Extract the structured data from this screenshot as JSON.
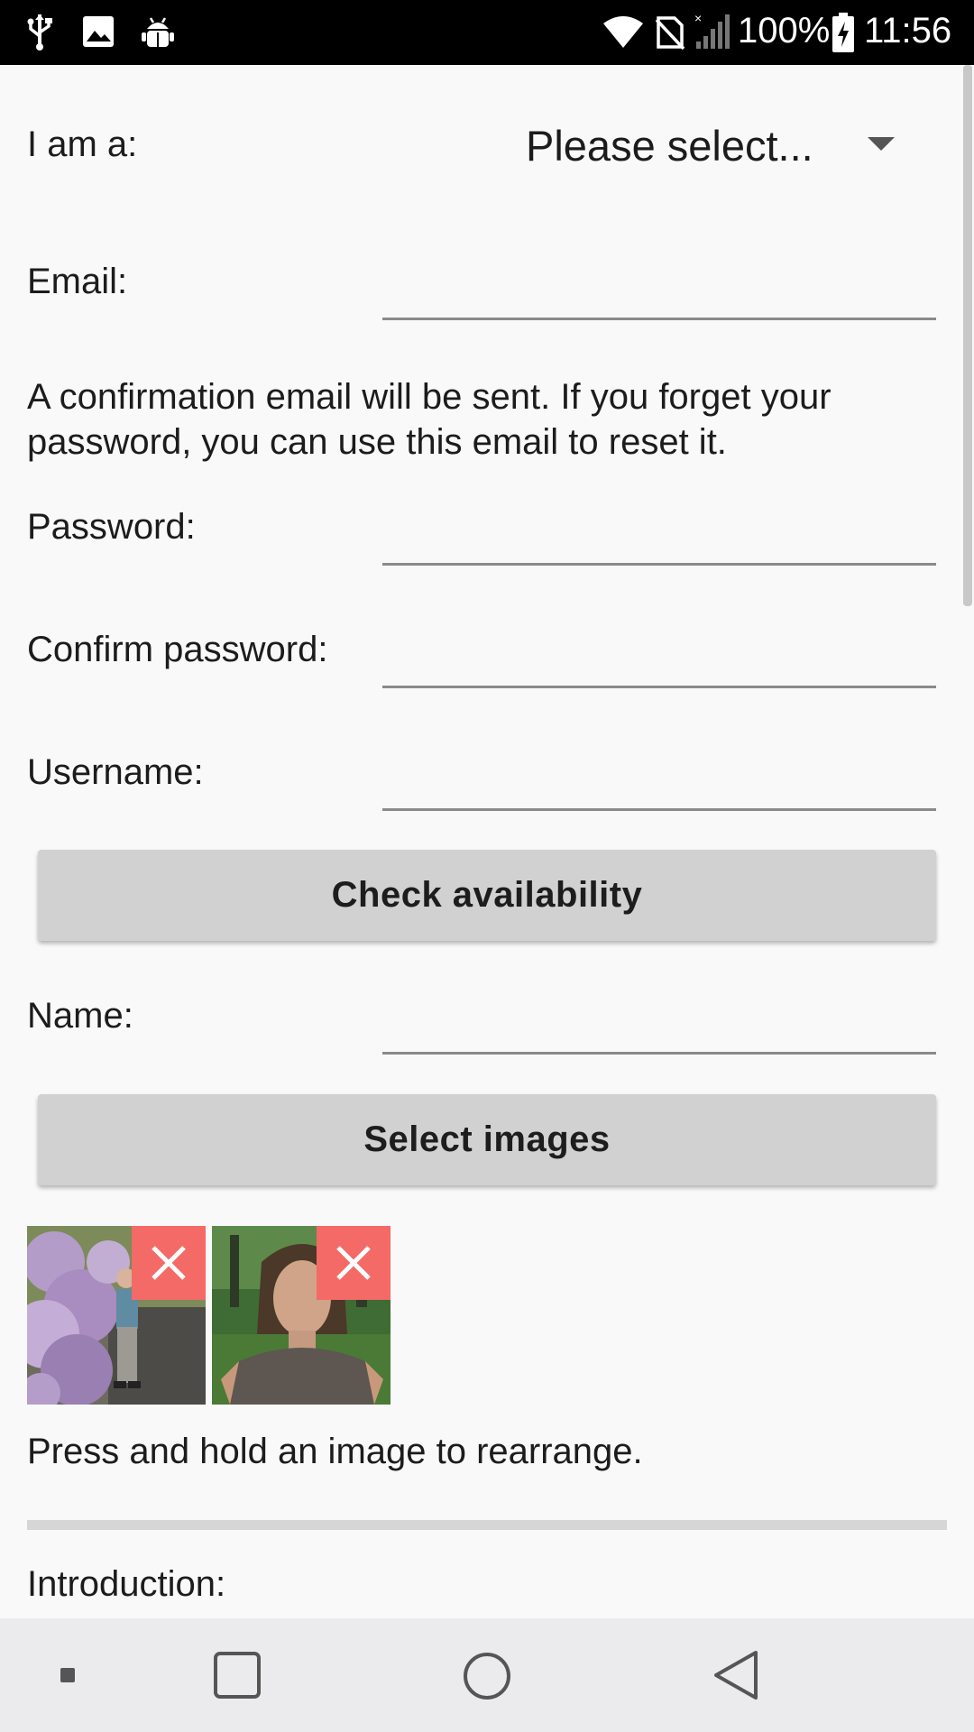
{
  "status_bar": {
    "battery": "100%",
    "time": "11:56",
    "icons": [
      "usb-icon",
      "image-icon",
      "android-debug-icon",
      "wifi-icon",
      "no-sim-icon",
      "signal-icon",
      "battery-charging-icon"
    ]
  },
  "form": {
    "role_label": "I am a:",
    "role_value": "Please select...",
    "email_label": "Email:",
    "email_value": "",
    "email_info": "A confirmation email will be sent. If you forget your password, you can use this email to reset it.",
    "password_label": "Password:",
    "password_value": "",
    "confirm_password_label": "Confirm password:",
    "confirm_password_value": "",
    "username_label": "Username:",
    "username_value": "",
    "check_availability_label": "Check availability",
    "name_label": "Name:",
    "name_value": "",
    "select_images_label": "Select images",
    "images": [
      {
        "description_icon": "photo-thumbnail-person-flowers",
        "remove_icon": "close-icon"
      },
      {
        "description_icon": "photo-thumbnail-person-portrait",
        "remove_icon": "close-icon"
      }
    ],
    "rearrange_hint": "Press and hold an image to rearrange.",
    "introduction_label": "Introduction:"
  },
  "colors": {
    "button_bg": "#d1d1d1",
    "remove_accent": "#f46a66",
    "background": "#f9f9fa",
    "nav_bar": "#ebebee"
  },
  "nav_bar": {
    "buttons": [
      "menu-dot-icon",
      "recents-square-icon",
      "home-circle-icon",
      "back-triangle-icon"
    ]
  }
}
